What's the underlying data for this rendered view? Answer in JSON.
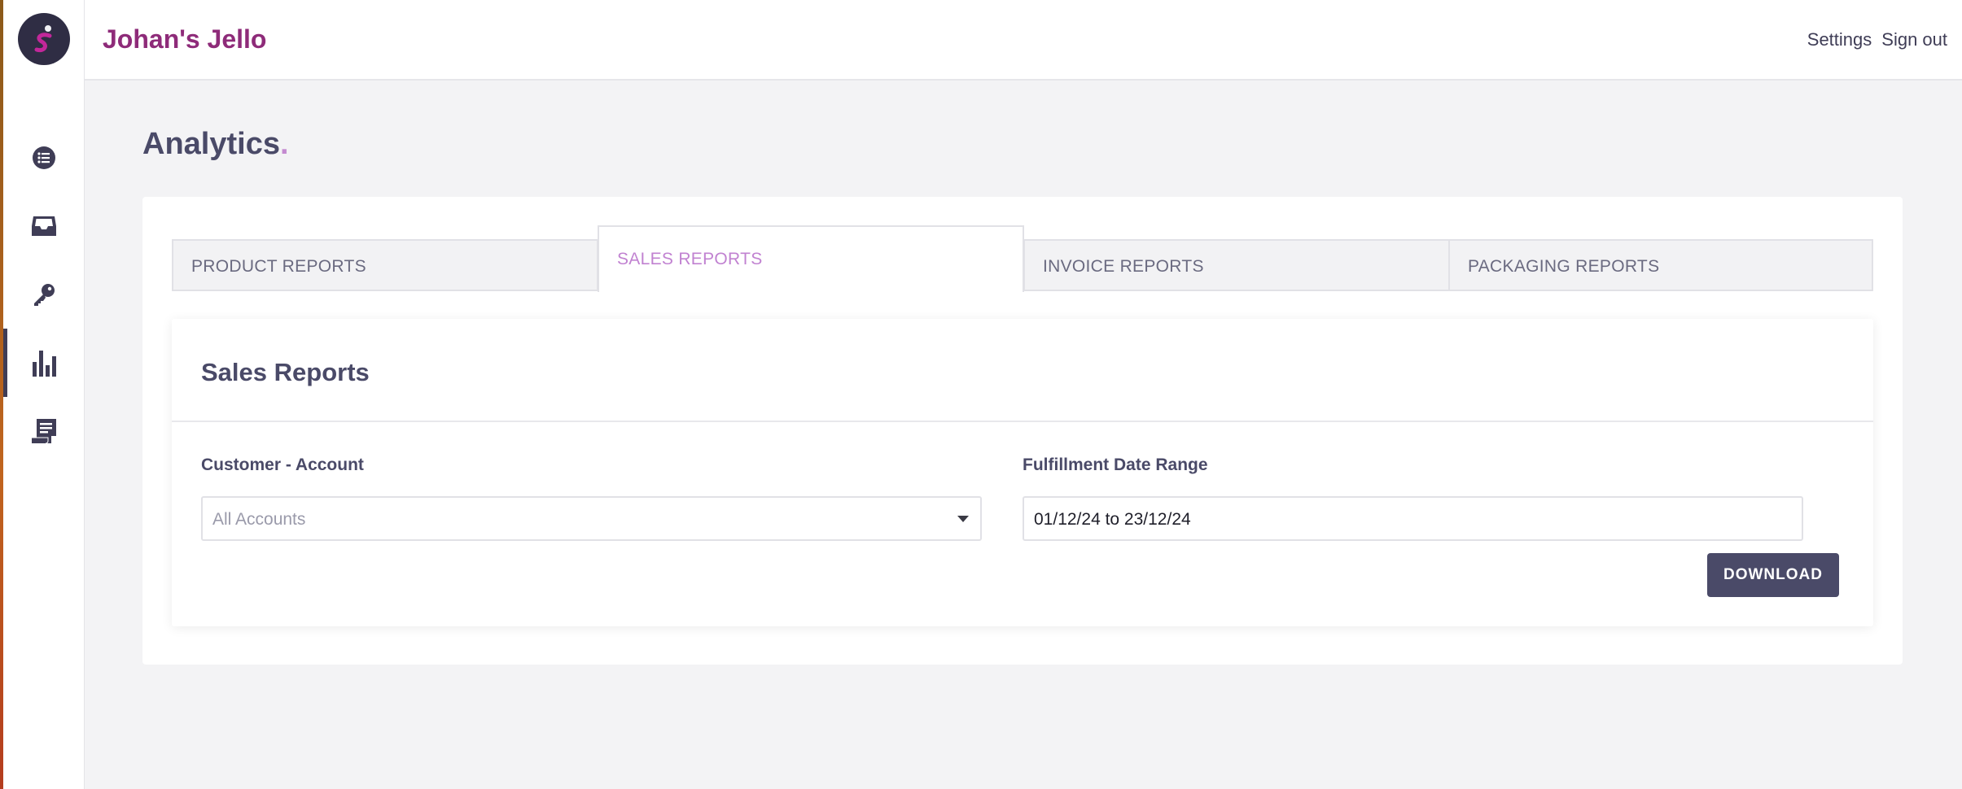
{
  "app": {
    "brand": "Johan's Jello",
    "logo_letter": "S"
  },
  "sidebar": {
    "items": [
      {
        "icon": "list-icon",
        "active": false
      },
      {
        "icon": "inbox-icon",
        "active": false
      },
      {
        "icon": "key-icon",
        "active": false
      },
      {
        "icon": "bar-chart-icon",
        "active": true
      },
      {
        "icon": "receipt-icon",
        "active": false
      }
    ]
  },
  "topbar": {
    "settings_label": "Settings",
    "signout_label": "Sign out"
  },
  "page": {
    "title": "Analytics",
    "title_dot": "."
  },
  "tabs": [
    {
      "label": "PRODUCT REPORTS",
      "active": false
    },
    {
      "label": "SALES REPORTS",
      "active": true
    },
    {
      "label": "INVOICE REPORTS",
      "active": false
    },
    {
      "label": "PACKAGING REPORTS",
      "active": false
    }
  ],
  "panel": {
    "title": "Sales Reports",
    "customer_label": "Customer - Account",
    "customer_placeholder": "All Accounts",
    "date_label": "Fulfillment Date Range",
    "date_value": "01/12/24 to 23/12/24",
    "download_label": "DOWNLOAD"
  },
  "colors": {
    "brand": "#8e2b79",
    "accent": "#c182d1",
    "dark": "#4a4a68",
    "logo_bg": "#2f2d44"
  }
}
